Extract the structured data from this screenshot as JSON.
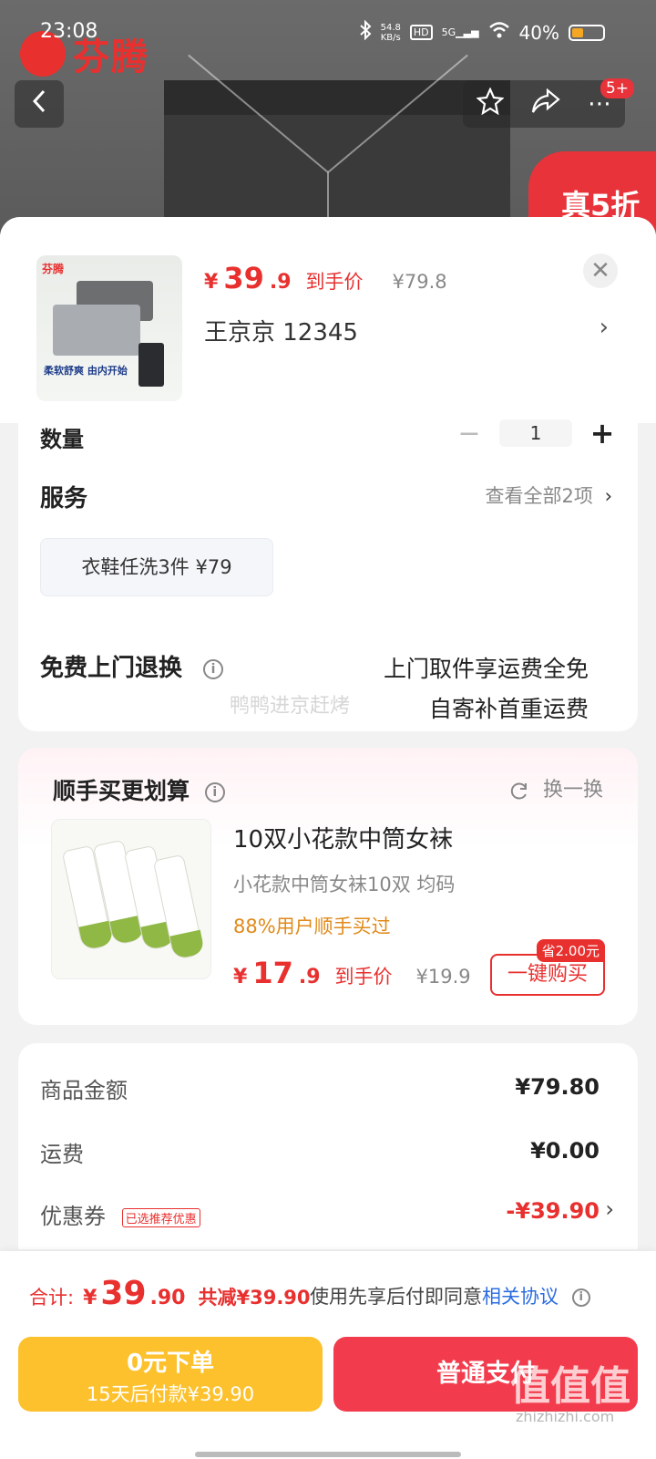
{
  "status_bar": {
    "time": "23:08",
    "net_speed": "54.8",
    "net_unit": "KB/s",
    "signal": "5G",
    "battery": "40%"
  },
  "brand": {
    "logo_text": "芬腾",
    "promo_badge": "真5折"
  },
  "nav": {
    "back_icon": "chevron-left-icon",
    "favorite_icon": "star-icon",
    "share_icon": "share-icon",
    "more_icon": "more-icon",
    "message_badge": "5+"
  },
  "product": {
    "thumb_caption": "柔软舒爽 由内开始",
    "price_yen": "¥",
    "price_int": "39",
    "price_dec": ".9",
    "price_tag": "到手价",
    "price_orig": "¥79.8",
    "address": "王京京  12345"
  },
  "options": {
    "qty_label": "数量",
    "qty_value": "1",
    "service_title": "服务",
    "service_more": "查看全部2项",
    "service_chip": "衣鞋任洗3件  ¥79",
    "return_title": "免费上门退换",
    "return_line1": "上门取件享运费全免",
    "return_line2": "自寄补首重运费"
  },
  "addon": {
    "title": "顺手买更划算",
    "swap": "换一换",
    "name": "10双小花款中筒女袜",
    "spec": "小花款中筒女袜10双   均码",
    "social": "88%用户顺手买过",
    "price_yen": "¥",
    "price_int": "17",
    "price_dec": ".9",
    "price_tag": "到手价",
    "price_orig": "¥19.9",
    "save_tag": "省2.00元",
    "buy_label": "一键购买"
  },
  "summary": {
    "goods_label": "商品金额",
    "goods_value": "¥79.80",
    "shipping_label": "运费",
    "shipping_value": "¥0.00",
    "coupon_label": "优惠券",
    "coupon_tag": "已选推荐优惠",
    "coupon_value": "-¥39.90"
  },
  "footer": {
    "total_label": "合计:",
    "total_yen": "¥",
    "total_int": "39",
    "total_dec": ".90",
    "total_save": "共减¥39.90",
    "agree_text": "使用先享后付即同意",
    "agree_link": "相关协议",
    "bnpl_main": "0元下单",
    "bnpl_sub": "15天后付款¥39.90",
    "pay_label": "普通支付"
  },
  "watermark": {
    "text": "值值值",
    "site": "zhizhizhi.com",
    "overlay": "鸭鸭进京赶烤"
  },
  "colors": {
    "accent_red": "#e8302f",
    "pay_red": "#f23c4d",
    "bnpl_yellow": "#fcc12c",
    "link_blue": "#2b6de0",
    "social_orange": "#e08a1a"
  }
}
